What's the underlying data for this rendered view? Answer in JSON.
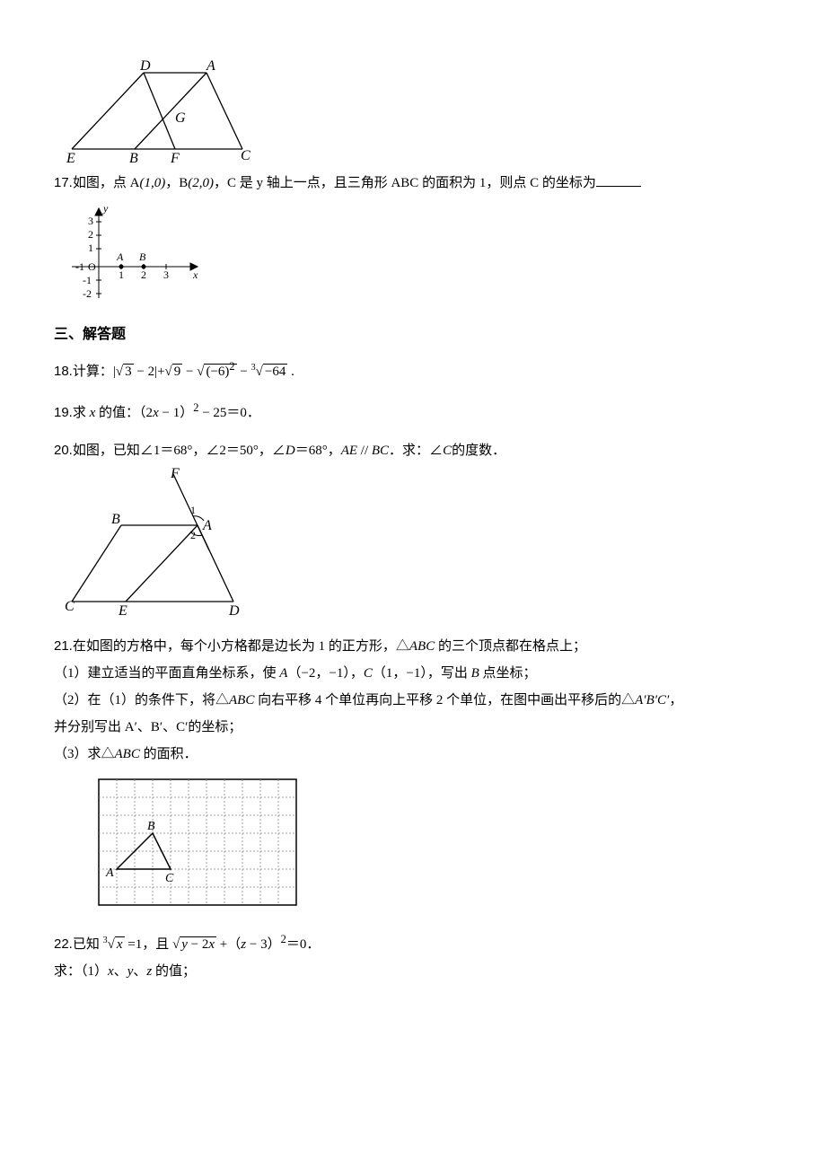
{
  "q17": {
    "num": "17.",
    "text_a": "如图，点 A",
    "coord_a": "(1,0)",
    "text_b": "，B",
    "coord_b": "(2,0)",
    "text_c": "，C 是 y 轴上一点，且三角形 ABC 的面积为 1，则点 C 的坐标为"
  },
  "section3": {
    "title": "三、解答题"
  },
  "q18": {
    "num": "18.",
    "text_prefix": "计算：|",
    "expr_a": "√3",
    "minus1": " − 2|+",
    "expr_b": "√9",
    "minus2": " − ",
    "expr_c": "√(−6)²",
    "minus3": " − ",
    "expr_d": "∛−64",
    "period": " ."
  },
  "q19": {
    "num": "19.",
    "text": "求 x 的值：（2x − 1）² − 25＝0．"
  },
  "q20": {
    "num": "20.",
    "text": "如图，已知∠1＝68°，∠2＝50°，∠D＝68°，AE // BC．求：∠C的度数．"
  },
  "q21": {
    "num": "21.",
    "line1": "在如图的方格中，每个小方格都是边长为 1 的正方形，△ABC 的三个顶点都在格点上；",
    "sub1": "（1）建立适当的平面直角坐标系，使 A（−2，−1），C（1，−1），写出 B 点坐标；",
    "sub2": "（2）在（1）的条件下，将△ABC 向右平移 4 个单位再向上平移 2 个单位，在图中画出平移后的△A′B′C′，",
    "sub2_cont": "并分别写出 A′、B′、C′的坐标；",
    "sub3": "（3）求△ABC 的面积．"
  },
  "q22": {
    "num": "22.",
    "text_a": "已知 ",
    "expr_a": "∛x",
    "text_b": " =1，且 ",
    "expr_b": "√(y − 2x)",
    "text_c": " +（z − 3）²＝0．",
    "sub1": "求：（1）x、y、z 的值；"
  }
}
